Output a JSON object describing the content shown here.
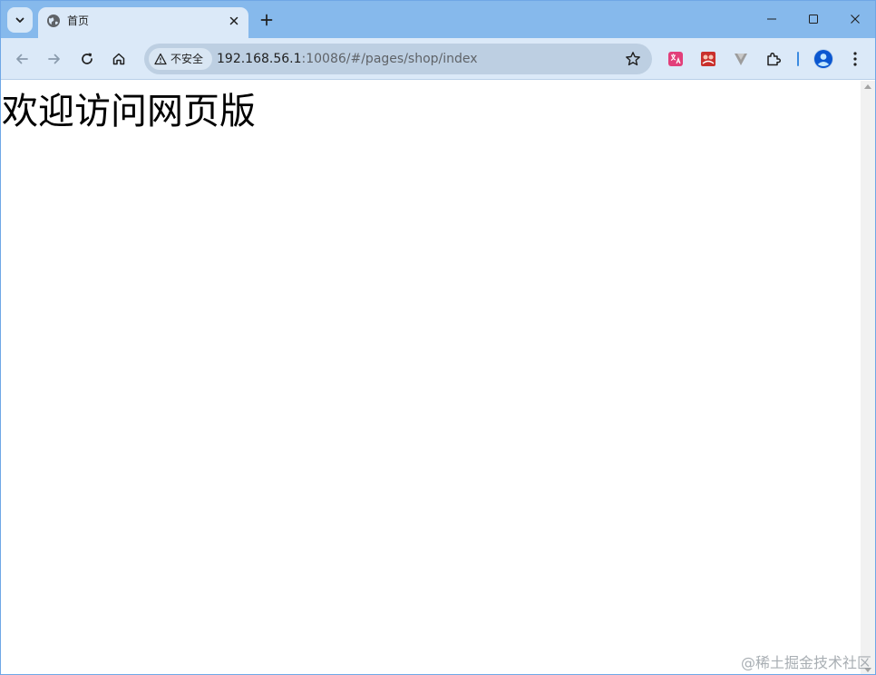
{
  "browser": {
    "tab": {
      "title": "首页"
    },
    "window_controls": {
      "minimize": "–",
      "maximize": "☐",
      "close": "✕"
    },
    "address_bar": {
      "security_label": "不安全",
      "url_host": "192.168.56.1",
      "url_rest": ":10086/#/pages/shop/index"
    },
    "colors": {
      "tabstrip": "#86b9ec",
      "toolbar": "#dbe9f8",
      "omnibox": "#bdcfe2"
    },
    "icons": [
      "tab-search-icon",
      "globe-icon",
      "close-icon",
      "plus-icon",
      "back-icon",
      "forward-icon",
      "reload-icon",
      "home-icon",
      "warning-icon",
      "star-icon",
      "translate-icon",
      "extension-icon",
      "v-extension-icon",
      "puzzle-icon",
      "profile-icon",
      "more-icon"
    ]
  },
  "page": {
    "heading": "欢迎访问网页版"
  },
  "watermark": "@稀土掘金技术社区"
}
